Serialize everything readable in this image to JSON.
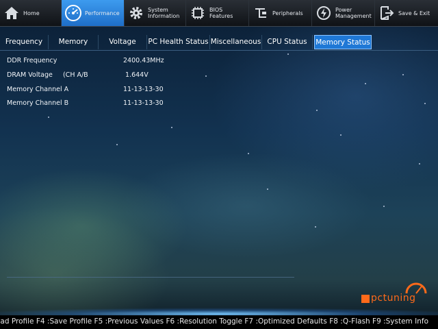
{
  "topnav": {
    "items": [
      {
        "label": "Home",
        "icon": "home-icon"
      },
      {
        "label": "Performance",
        "icon": "speedometer-icon"
      },
      {
        "label": "System\nInformation",
        "icon": "gear-icon"
      },
      {
        "label": "BIOS\nFeatures",
        "icon": "chip-icon"
      },
      {
        "label": "Peripherals",
        "icon": "plug-icon"
      },
      {
        "label": "Power\nManagement",
        "icon": "power-icon"
      },
      {
        "label": "Save & Exit",
        "icon": "exit-door-icon"
      }
    ],
    "active": "Performance",
    "accent": "#1e6ec8"
  },
  "subtabs": {
    "items": [
      "Frequency",
      "Memory",
      "Voltage",
      "PC Health Status",
      "Miscellaneous",
      "CPU Status",
      "Memory Status"
    ],
    "active": "Memory Status",
    "active_color": "#1f78d6"
  },
  "status": {
    "rows": [
      {
        "label": "DDR Frequency",
        "value": "2400.43MHz"
      },
      {
        "label": "DRAM Voltage     (CH A/B",
        "value": " 1.644V"
      },
      {
        "label": "Memory Channel A",
        "value": "11-13-13-30"
      },
      {
        "label": "Memory Channel B",
        "value": "11-13-13-30"
      }
    ]
  },
  "footer": {
    "hotkeys": "oad Profile F4 :Save Profile F5 :Previous Values F6 :Resolution Toggle F7 :Optimized Defaults F8 :Q-Flash F9 :System Info"
  },
  "watermark": {
    "text": "pctuning",
    "color": "#ff6a1a"
  }
}
